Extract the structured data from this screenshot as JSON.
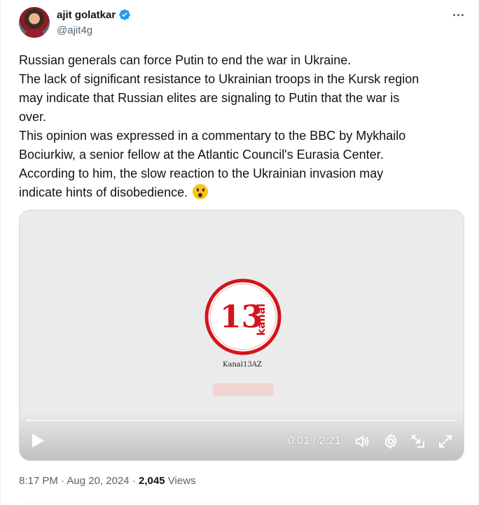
{
  "author": {
    "display_name": "ajit golatkar",
    "handle": "@ajit4g",
    "verified": true,
    "verified_color": "#1d9bf0"
  },
  "tweet": {
    "lines": [
      "Russian generals can force Putin to end the war in Ukraine.",
      "The lack of significant resistance to Ukrainian troops in the Kursk region",
      "may indicate that Russian elites are signaling to Putin that the war is",
      "over.",
      "This opinion was expressed in a commentary to the BBC by Mykhailo",
      "Bociurkiw, a senior fellow at the Atlantic Council's Eurasia Center.",
      "According to him, the slow reaction to the Ukrainian invasion may",
      "indicate hints of disobedience."
    ],
    "emoji": "astonished-face-emoji"
  },
  "media": {
    "logo_number": "13",
    "logo_word": "kanal",
    "logo_color": "#d4141c",
    "logo_caption": "Kanal13AZ",
    "time_display": "0:01 / 2:21",
    "progress_fraction": 0.007,
    "icons": [
      "play-icon",
      "volume-icon",
      "settings-icon",
      "minimize-icon",
      "fullscreen-icon"
    ]
  },
  "meta": {
    "time": "8:17 PM",
    "sep1": " · ",
    "date": "Aug 20, 2024",
    "sep2": " · ",
    "views_count": "2,045",
    "views_label": " Views"
  }
}
